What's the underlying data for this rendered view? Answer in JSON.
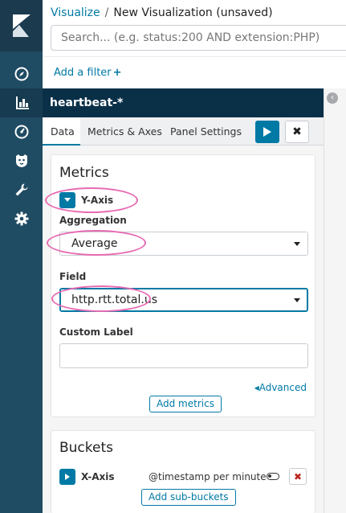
{
  "header": {
    "breadcrumb_parent": "Visualize",
    "breadcrumb_separator": "/",
    "breadcrumb_current": "New Visualization (unsaved)"
  },
  "search": {
    "placeholder": "Search... (e.g. status:200 AND extension:PHP)"
  },
  "filter": {
    "add_label": "Add a filter",
    "add_icon": "+"
  },
  "sidebar": {
    "logo": "kibana-logo",
    "items": [
      {
        "icon": "compass-icon",
        "label": "Discover"
      },
      {
        "icon": "bar-chart-icon",
        "label": "Visualize",
        "active": true
      },
      {
        "icon": "dashboard-icon",
        "label": "Dashboard"
      },
      {
        "icon": "timelion-icon",
        "label": "Timelion"
      },
      {
        "icon": "wrench-icon",
        "label": "Dev Tools"
      },
      {
        "icon": "gear-icon",
        "label": "Management"
      }
    ]
  },
  "index_pattern": {
    "title": "heartbeat-*"
  },
  "tabs": [
    {
      "label": "Data",
      "active": true
    },
    {
      "label": "Metrics & Axes",
      "active": false
    },
    {
      "label": "Panel Settings",
      "active": false
    }
  ],
  "actions": {
    "apply_icon": "play-icon",
    "discard_label": "✖"
  },
  "metrics": {
    "title": "Metrics",
    "agg_name": "Y-Axis",
    "aggregation_label": "Aggregation",
    "aggregation_value": "Average",
    "field_label": "Field",
    "field_value": "http.rtt.total.us",
    "custom_label_label": "Custom Label",
    "custom_label_value": "",
    "advanced_label": "Advanced",
    "advanced_icon": "◂",
    "add_button": "Add metrics"
  },
  "buckets": {
    "title": "Buckets",
    "agg_name": "X-Axis",
    "field_summary": "@timestamp per minute",
    "remove_label": "✖",
    "add_button": "Add sub-buckets"
  },
  "colors": {
    "nav_bg": "#1f4b63",
    "index_bar_bg": "#0a3048",
    "accent": "#0079a5",
    "highlight_ring": "#e76bb3",
    "danger": "#bd271e"
  }
}
